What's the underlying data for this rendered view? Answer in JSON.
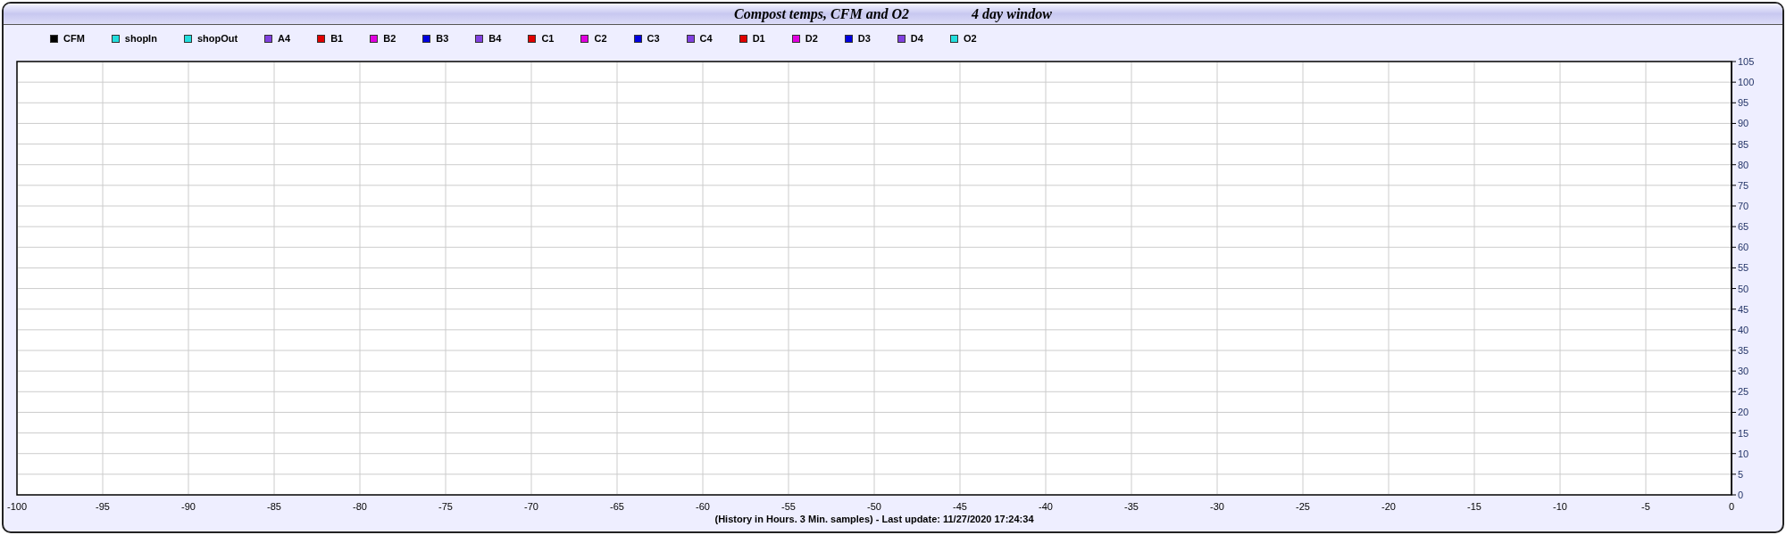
{
  "window": {
    "title": "Compost temps, CFM and O2",
    "subtitle": "4 day window"
  },
  "chart_data": {
    "type": "line",
    "xlabel": "(History in Hours. 3 Min. samples) - Last update: 11/27/2020 17:24:34",
    "series": [
      {
        "name": "CFM",
        "color": "#000000",
        "values": [
          null,
          null,
          null,
          null,
          null,
          null,
          null,
          null,
          null,
          null,
          null,
          null,
          null,
          null,
          null,
          null,
          null,
          null,
          null,
          null,
          null
        ]
      },
      {
        "name": "shopIn",
        "color": "#22dddd",
        "values": [
          null,
          null,
          null,
          null,
          null,
          null,
          null,
          null,
          null,
          null,
          null,
          null,
          null,
          null,
          null,
          null,
          null,
          null,
          null,
          null,
          null
        ]
      },
      {
        "name": "shopOut",
        "color": "#22dddd",
        "values": [
          null,
          null,
          null,
          null,
          null,
          null,
          null,
          null,
          null,
          null,
          null,
          null,
          null,
          null,
          null,
          null,
          null,
          null,
          null,
          null,
          null
        ]
      },
      {
        "name": "A4",
        "color": "#8040e0",
        "values": [
          null,
          null,
          null,
          null,
          null,
          null,
          null,
          null,
          null,
          null,
          null,
          null,
          null,
          null,
          null,
          null,
          null,
          null,
          null,
          null,
          null
        ]
      },
      {
        "name": "B1",
        "color": "#e00000",
        "values": [
          null,
          null,
          null,
          null,
          null,
          null,
          null,
          null,
          null,
          null,
          null,
          null,
          null,
          null,
          null,
          null,
          null,
          null,
          null,
          null,
          null
        ]
      },
      {
        "name": "B2",
        "color": "#e000e0",
        "values": [
          null,
          null,
          null,
          null,
          null,
          null,
          null,
          null,
          null,
          null,
          null,
          null,
          null,
          null,
          null,
          null,
          null,
          null,
          null,
          null,
          null
        ]
      },
      {
        "name": "B3",
        "color": "#0000e0",
        "values": [
          null,
          null,
          null,
          null,
          null,
          null,
          null,
          null,
          null,
          null,
          null,
          null,
          null,
          null,
          null,
          null,
          null,
          null,
          null,
          null,
          null
        ]
      },
      {
        "name": "B4",
        "color": "#8040e0",
        "values": [
          null,
          null,
          null,
          null,
          null,
          null,
          null,
          null,
          null,
          null,
          null,
          null,
          null,
          null,
          null,
          null,
          null,
          null,
          null,
          null,
          null
        ]
      },
      {
        "name": "C1",
        "color": "#e00000",
        "values": [
          null,
          null,
          null,
          null,
          null,
          null,
          null,
          null,
          null,
          null,
          null,
          null,
          null,
          null,
          null,
          null,
          null,
          null,
          null,
          null,
          null
        ]
      },
      {
        "name": "C2",
        "color": "#e000e0",
        "values": [
          null,
          null,
          null,
          null,
          null,
          null,
          null,
          null,
          null,
          null,
          null,
          null,
          null,
          null,
          null,
          null,
          null,
          null,
          null,
          null,
          null
        ]
      },
      {
        "name": "C3",
        "color": "#0000e0",
        "values": [
          null,
          null,
          null,
          null,
          null,
          null,
          null,
          null,
          null,
          null,
          null,
          null,
          null,
          null,
          null,
          null,
          null,
          null,
          null,
          null,
          null
        ]
      },
      {
        "name": "C4",
        "color": "#8040e0",
        "values": [
          null,
          null,
          null,
          null,
          null,
          null,
          null,
          null,
          null,
          null,
          null,
          null,
          null,
          null,
          null,
          null,
          null,
          null,
          null,
          null,
          null
        ]
      },
      {
        "name": "D1",
        "color": "#e00000",
        "values": [
          null,
          null,
          null,
          null,
          null,
          null,
          null,
          null,
          null,
          null,
          null,
          null,
          null,
          null,
          null,
          null,
          null,
          null,
          null,
          null,
          null
        ]
      },
      {
        "name": "D2",
        "color": "#e000e0",
        "values": [
          null,
          null,
          null,
          null,
          null,
          null,
          null,
          null,
          null,
          null,
          null,
          null,
          null,
          null,
          null,
          null,
          null,
          null,
          null,
          null,
          null
        ]
      },
      {
        "name": "D3",
        "color": "#0000e0",
        "values": [
          null,
          null,
          null,
          null,
          null,
          null,
          null,
          null,
          null,
          null,
          null,
          null,
          null,
          null,
          null,
          null,
          null,
          null,
          null,
          null,
          null
        ]
      },
      {
        "name": "D4",
        "color": "#8040e0",
        "values": [
          null,
          null,
          null,
          null,
          null,
          null,
          null,
          null,
          null,
          null,
          null,
          null,
          null,
          null,
          null,
          null,
          null,
          null,
          null,
          null,
          null
        ]
      },
      {
        "name": "O2",
        "color": "#22dddd",
        "values": [
          null,
          null,
          null,
          null,
          null,
          null,
          null,
          null,
          null,
          null,
          null,
          null,
          null,
          null,
          null,
          null,
          null,
          null,
          null,
          null,
          null
        ]
      }
    ],
    "categories": [
      "-100",
      "-95",
      "-90",
      "-85",
      "-80",
      "-75",
      "-70",
      "-65",
      "-60",
      "-55",
      "-50",
      "-45",
      "-40",
      "-35",
      "-30",
      "-25",
      "-20",
      "-15",
      "-10",
      "-5",
      "0"
    ],
    "grid": true,
    "ylim": [
      0,
      105
    ],
    "yticks": [
      0,
      5,
      10,
      15,
      20,
      25,
      30,
      35,
      40,
      45,
      50,
      55,
      60,
      65,
      70,
      75,
      80,
      85,
      90,
      95,
      100,
      105
    ]
  }
}
